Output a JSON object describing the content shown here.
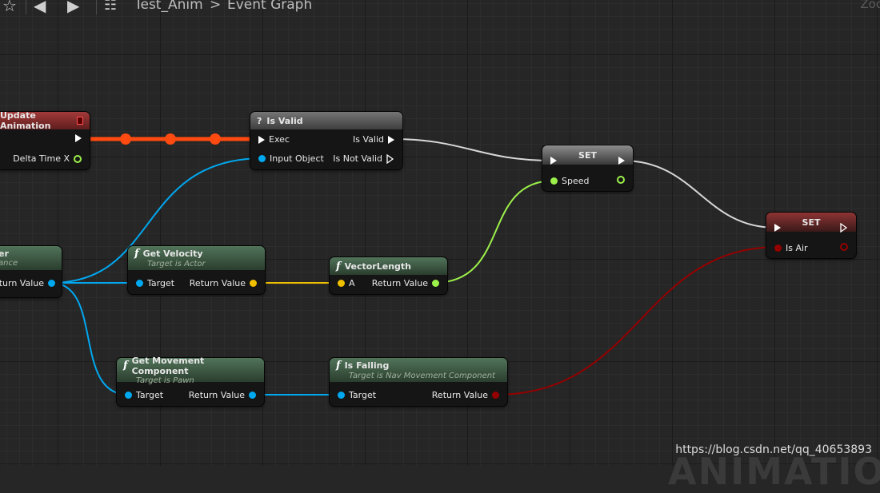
{
  "toolbar": {
    "breadcrumb_asset": "Test_Anim",
    "breadcrumb_separator": ">",
    "breadcrumb_graph": "Event Graph",
    "zoom_label": "Zoo"
  },
  "nodes": {
    "update_animation": {
      "title": "Update Animation",
      "pin_delta": "Delta Time X"
    },
    "try_get_pawn_owner": {
      "title": "er",
      "subtitle": "ance",
      "pin_return": "eturn Value"
    },
    "is_valid": {
      "icon": "?",
      "title": "Is Valid",
      "pin_exec": "Exec",
      "pin_input": "Input Object",
      "pin_is_valid": "Is Valid",
      "pin_not_valid": "Is Not Valid"
    },
    "get_velocity": {
      "title": "Get Velocity",
      "subtitle": "Target is Actor",
      "pin_target": "Target",
      "pin_return": "Return Value"
    },
    "vector_length": {
      "title": "VectorLength",
      "pin_a": "A",
      "pin_return": "Return Value"
    },
    "set_speed": {
      "title": "SET",
      "pin_speed": "Speed"
    },
    "set_is_air": {
      "title": "SET",
      "pin_is_air": "Is Air"
    },
    "get_movement_component": {
      "title": "Get Movement Component",
      "subtitle": "Target is Pawn",
      "pin_target": "Target",
      "pin_return": "Return Value"
    },
    "is_falling": {
      "title": "Is Falling",
      "subtitle": "Target is Nav Movement Component",
      "pin_target": "Target",
      "pin_return": "Return Value"
    }
  },
  "function_glyph": "f",
  "colors": {
    "object_pin": "#00a8f0",
    "vector_pin": "#f0c000",
    "float_pin": "#9cf04a",
    "bool_pin": "#950000",
    "exec_wire": "#ffffff",
    "active_exec_wire": "#ff4a10"
  },
  "watermark": "https://blog.csdn.net/qq_40653893",
  "background_text": "ANIMATIO"
}
